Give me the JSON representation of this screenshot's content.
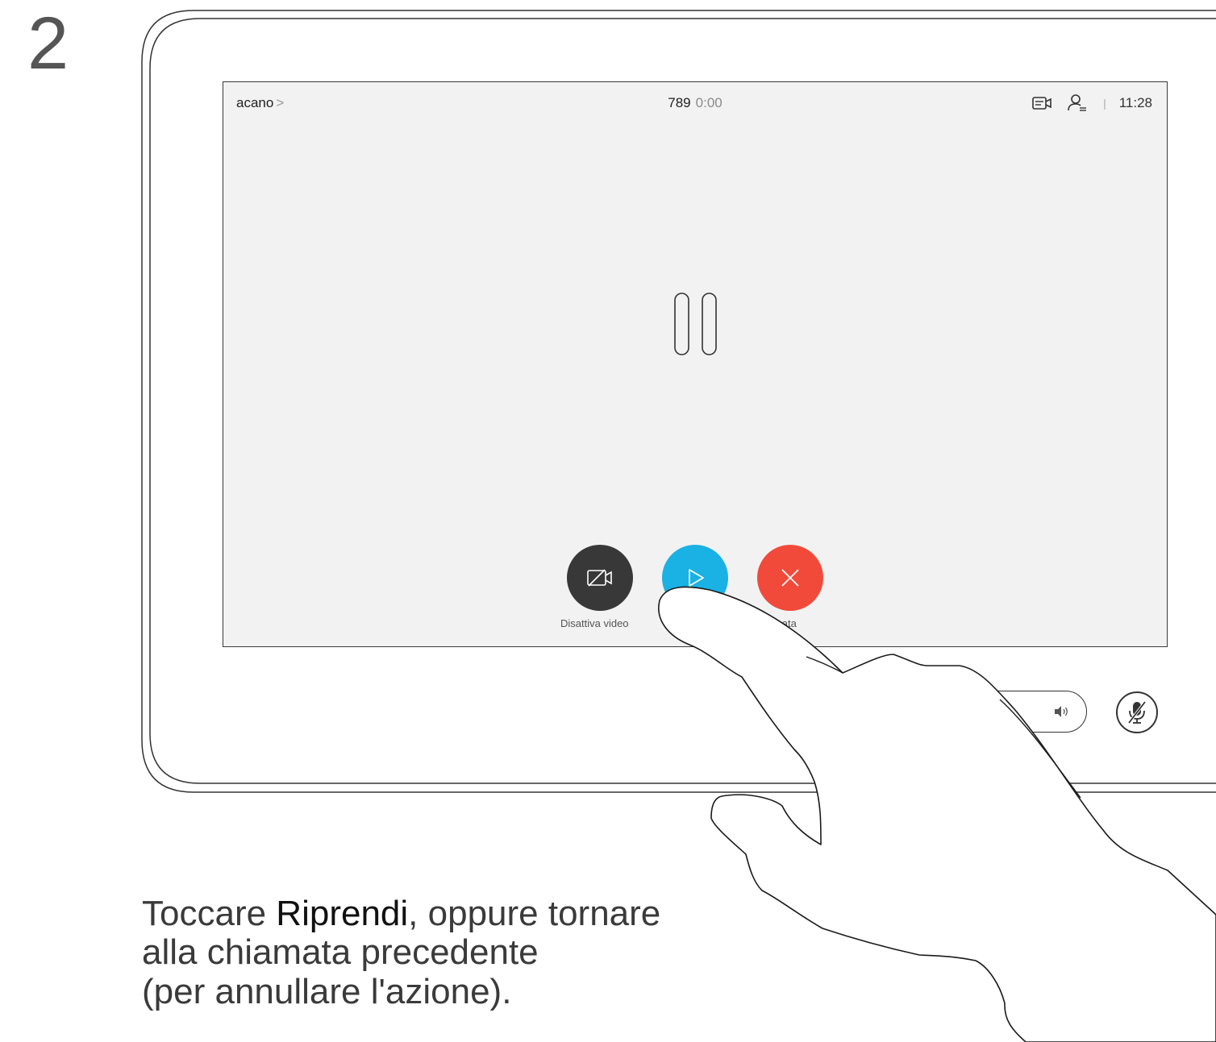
{
  "step": {
    "number": "2"
  },
  "status_bar": {
    "contact": "acano",
    "chevron": ">",
    "call_number": "789",
    "call_timer": "0:00",
    "separator": "|",
    "clock": "11:28",
    "icons": [
      "self-view-icon",
      "participants-icon"
    ]
  },
  "screen": {
    "state_icon": "pause-icon"
  },
  "controls": {
    "video_label": "Disattiva video",
    "video_icon": "camera-off-icon",
    "resume_icon": "play-icon",
    "end_label": "na chiamata",
    "end_icon": "close-icon"
  },
  "hardware": {
    "volume_icon": "speaker-icon",
    "mute_icon": "mic-muted-icon"
  },
  "instruction": {
    "part1": "Toccare ",
    "bold": "Riprendi",
    "part2": ", oppure tornare",
    "line2": "alla chiamata precedente",
    "line3": "(per annullare l'azione)."
  },
  "colors": {
    "resume": "#1ab1e4",
    "end_call": "#f24a3a",
    "video_button": "#383838",
    "screen_bg": "#f2f2f2"
  }
}
